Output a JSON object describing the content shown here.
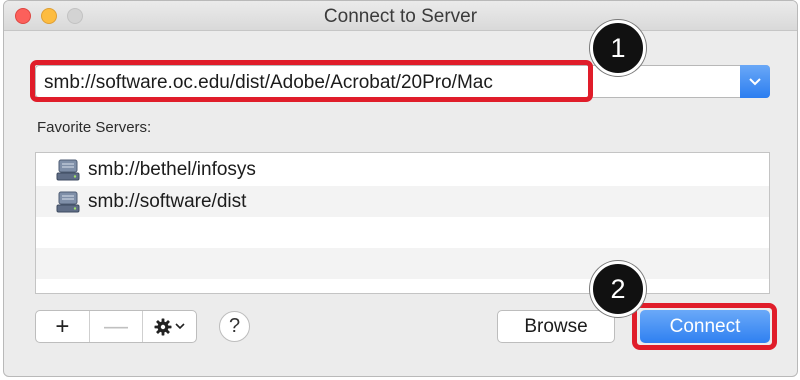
{
  "window": {
    "title": "Connect to Server"
  },
  "address": {
    "value": "smb://software.oc.edu/dist/Adobe/Acrobat/20Pro/Mac",
    "dropdown_icon": "chevron-down-icon"
  },
  "annotations": {
    "step1": "1",
    "step2": "2",
    "highlight_color": "#e01d2a"
  },
  "favorites": {
    "label": "Favorite Servers:",
    "items": [
      {
        "label": "smb://bethel/infosys",
        "icon": "network-drive-icon"
      },
      {
        "label": "smb://software/dist",
        "icon": "network-drive-icon"
      }
    ]
  },
  "toolbar": {
    "add_label": "+",
    "remove_label": "—",
    "gear_icon": "gear-icon",
    "help_label": "?"
  },
  "buttons": {
    "browse_label": "Browse",
    "connect_label": "Connect",
    "accent_color": "#2f80f1"
  }
}
